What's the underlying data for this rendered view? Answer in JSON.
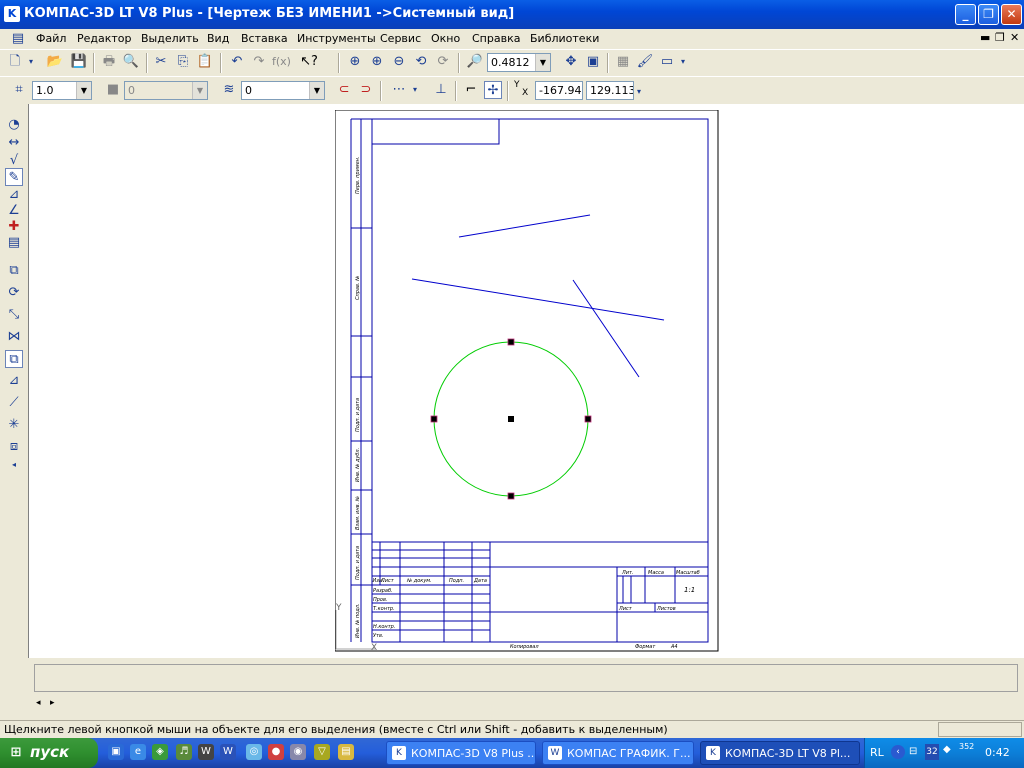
{
  "window": {
    "title": "КОМПАС-3D LT V8 Plus - [Чертеж БЕЗ ИМЕНИ1 ->Системный вид]"
  },
  "menu": {
    "items": [
      "Файл",
      "Редактор",
      "Выделить",
      "Вид",
      "Вставка",
      "Инструменты",
      "Сервис",
      "Окно",
      "Справка",
      "Библиотеки"
    ]
  },
  "toolbar1": {
    "zoom_value": "0.4812"
  },
  "toolbar2": {
    "line_weight": "1.0",
    "style_value": "0",
    "layer_value": "0",
    "coord_label_y": "Y",
    "coord_label_x": "X",
    "coord_x": "-167.94",
    "coord_y": "129.113"
  },
  "colors": {
    "sheet_frame": "#0000aa",
    "geometry_line": "#0000cc",
    "circle": "#00cc00",
    "titlebar": "#0046d5"
  },
  "sheet": {
    "side_labels": [
      "Перв. примен.",
      "Справ. №",
      "Подп. и дата",
      "Инв. № дубл.",
      "Взам. инв. №",
      "Подп. и дата",
      "Инв. № подл."
    ],
    "title_block": {
      "row_labels": [
        "Изм.",
        "Лист",
        "№ докум.",
        "Подп.",
        "Дата"
      ],
      "left_rows": [
        "Разраб.",
        "Пров.",
        "Т.контр.",
        "Н.контр.",
        "Утв."
      ],
      "lit": "Лит.",
      "mass": "Масса",
      "scale": "Масштаб",
      "scale_value": "1:1",
      "sheet": "Лист",
      "sheets": "Листов",
      "copied": "Копировал",
      "format": "Формат",
      "format_value": "A4"
    },
    "axis_y": "Y",
    "axis_x": "X"
  },
  "command_panel": {
    "text": ""
  },
  "status": {
    "text": "Щелкните левой кнопкой мыши на объекте для его выделения (вместе с Ctrl или Shift - добавить к выделенным)"
  },
  "taskbar": {
    "start_label": "пуск",
    "buttons": [
      "КОМПАС-3D V8 Plus ...",
      "КОМПАС ГРАФИК. Г...",
      "КОМПАС-3D LT V8 Pl..."
    ],
    "lang": "RL",
    "clock": "0:42",
    "tray_num1": "32",
    "tray_num2": "352"
  }
}
